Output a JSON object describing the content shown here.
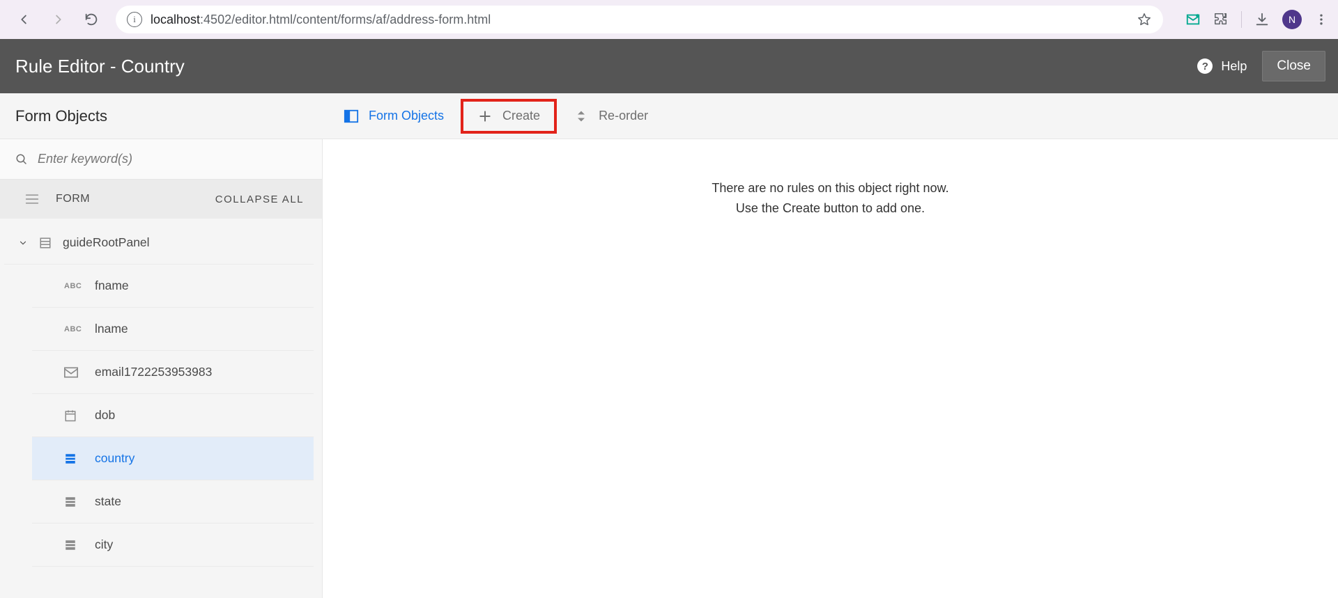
{
  "browser": {
    "url_host": "localhost",
    "url_port_path": ":4502/editor.html/content/forms/af/address-form.html",
    "avatar_initial": "N"
  },
  "app": {
    "title": "Rule Editor - Country",
    "help_label": "Help",
    "close_label": "Close"
  },
  "sidebar": {
    "heading": "Form Objects",
    "search_placeholder": "Enter keyword(s)",
    "form_label": "FORM",
    "collapse_label": "COLLAPSE ALL",
    "root_label": "guideRootPanel",
    "items": [
      {
        "type": "ABC",
        "label": "fname"
      },
      {
        "type": "ABC",
        "label": "lname"
      },
      {
        "type": "email",
        "label": "email1722253953983"
      },
      {
        "type": "date",
        "label": "dob"
      },
      {
        "type": "dropdown",
        "label": "country",
        "selected": true
      },
      {
        "type": "dropdown",
        "label": "state"
      },
      {
        "type": "dropdown",
        "label": "city"
      }
    ]
  },
  "toolbar": {
    "form_objects": "Form Objects",
    "create": "Create",
    "reorder": "Re-order"
  },
  "content": {
    "empty_line1": "There are no rules on this object right now.",
    "empty_line2": "Use the Create button to add one."
  }
}
